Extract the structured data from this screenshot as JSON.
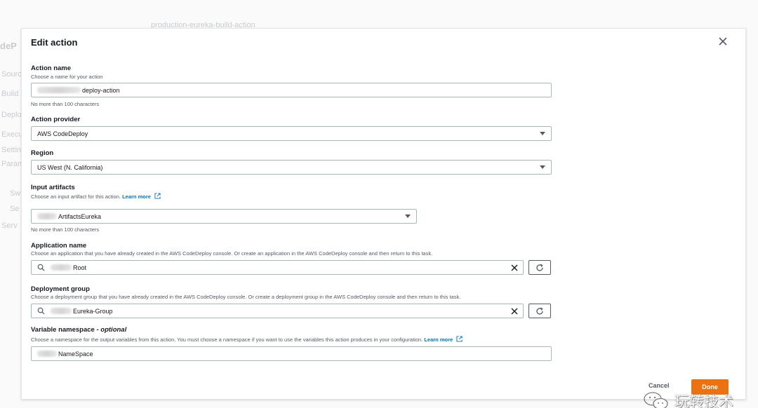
{
  "background": {
    "breadcrumb": "production-eureka-build-action",
    "page_fragment": "deP",
    "sidebar_fragments": [
      "Source",
      "Build",
      "Deploy",
      "Execu",
      "Settin",
      "Parame",
      "Sw",
      "Se",
      "Serv"
    ]
  },
  "modal": {
    "title": "Edit action",
    "action_name": {
      "label": "Action name",
      "description": "Choose a name for your action",
      "value": "deploy-action",
      "hint": "No more than 100 characters"
    },
    "action_provider": {
      "label": "Action provider",
      "value": "AWS CodeDeploy"
    },
    "region": {
      "label": "Region",
      "value": "US West (N. California)"
    },
    "input_artifacts": {
      "label": "Input artifacts",
      "description": "Choose an input artifact for this action.",
      "link": "Learn more",
      "value": "ArtifactsEureka",
      "hint": "No more than 100 characters"
    },
    "application_name": {
      "label": "Application name",
      "description": "Choose an application that you have already created in the AWS CodeDeploy console. Or create an application in the AWS CodeDeploy console and then return to this task.",
      "value": "Root"
    },
    "deployment_group": {
      "label": "Deployment group",
      "description": "Choose a deployment group that you have already created in the AWS CodeDeploy console. Or create a deployment group in the AWS CodeDeploy console and then return to this task.",
      "value": "Eureka-Group"
    },
    "variable_namespace": {
      "label": "Variable namespace - ",
      "label_optional": "optional",
      "description": "Choose a namespace for the output variables from this action. You must choose a namespace if you want to use the variables this action produces in your configuration.",
      "link": "Learn more",
      "value": "NameSpace"
    },
    "cancel_label": "Cancel",
    "done_label": "Done"
  },
  "watermark": {
    "text": "玩转技术",
    "icon": "wechat-icon"
  },
  "colors": {
    "primary": "#ec7211",
    "link": "#0073bb",
    "border": "#aab7b8",
    "text": "#16191f",
    "muted": "#545b64"
  }
}
